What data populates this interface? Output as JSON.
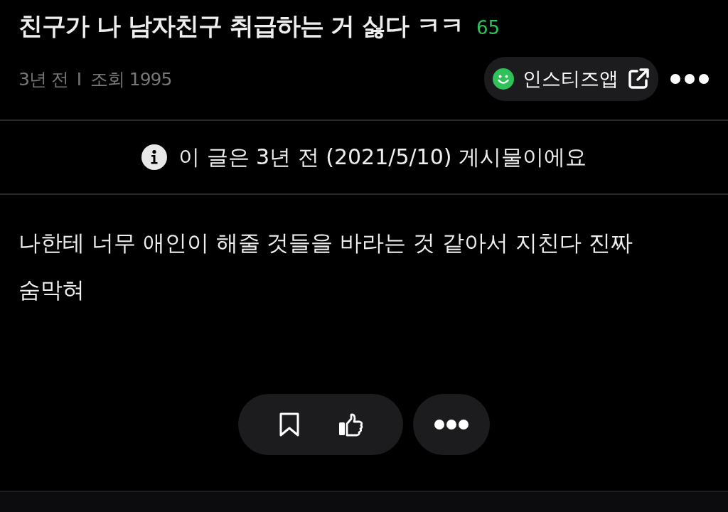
{
  "post": {
    "title": "친구가 나 남자친구 취급하는 거 싫다 ㅋㅋ",
    "comment_count": "65",
    "time": "3년 전",
    "views": "조회 1995"
  },
  "app_button": {
    "label": "인스티즈앱"
  },
  "notice": "이 글은 3년 전 (2021/5/10) 게시물이에요",
  "body_lines": [
    "나한테 너무 애인이 해줄 것들을 바라는 것 같아서 지친다 진짜",
    "숨막혀"
  ]
}
